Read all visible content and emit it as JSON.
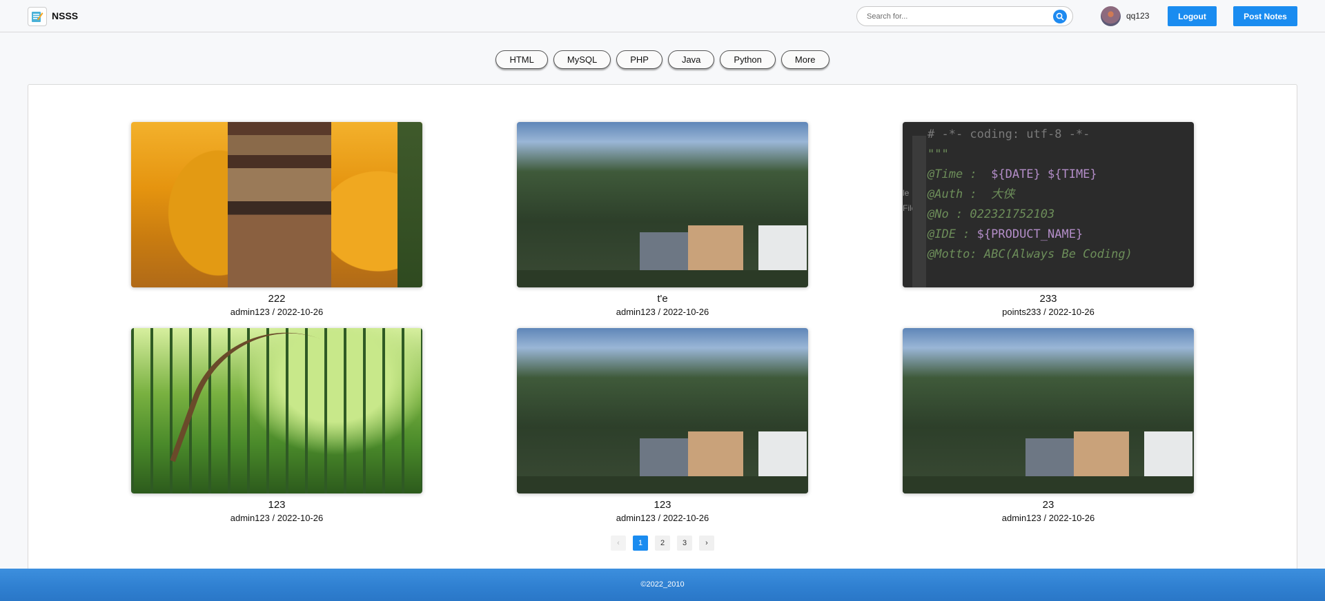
{
  "header": {
    "brand": "NSSS",
    "search_placeholder": "Search for...",
    "username": "qq123",
    "logout_label": "Logout",
    "post_label": "Post Notes",
    "accent_color": "#1a8cf0"
  },
  "categories": [
    "HTML",
    "MySQL",
    "PHP",
    "Java",
    "Python",
    "More"
  ],
  "posts": [
    {
      "title": "222",
      "author": "admin123",
      "date": "2022-10-26",
      "image": "autumn-pagoda"
    },
    {
      "title": "t'e",
      "author": "admin123",
      "date": "2022-10-26",
      "image": "houses"
    },
    {
      "title": "233",
      "author": "points233",
      "date": "2022-10-26",
      "image": "code-editor"
    },
    {
      "title": "123",
      "author": "admin123",
      "date": "2022-10-26",
      "image": "bamboo-forest"
    },
    {
      "title": "123",
      "author": "admin123",
      "date": "2022-10-26",
      "image": "houses"
    },
    {
      "title": "23",
      "author": "admin123",
      "date": "2022-10-26",
      "image": "houses"
    }
  ],
  "code_snippet": {
    "l1": "# -*- coding: utf-8 -*-",
    "l2": "\"\"\"",
    "l3a": "@Time : ",
    "l3b": " ${DATE} ${TIME}",
    "l4a": "@Auth : ",
    "l4b": " 大侠",
    "l5": "@No : 022321752103",
    "l6a": "@IDE : ",
    "l6b": "${PRODUCT_NAME}",
    "l7": "@Motto: ABC(Always Be Coding)",
    "side1": "le",
    "side2": "File"
  },
  "pagination": {
    "prev": "‹",
    "pages": [
      "1",
      "2",
      "3"
    ],
    "current": "1",
    "next": "›"
  },
  "footer": {
    "copyright": "©2022_2010"
  }
}
